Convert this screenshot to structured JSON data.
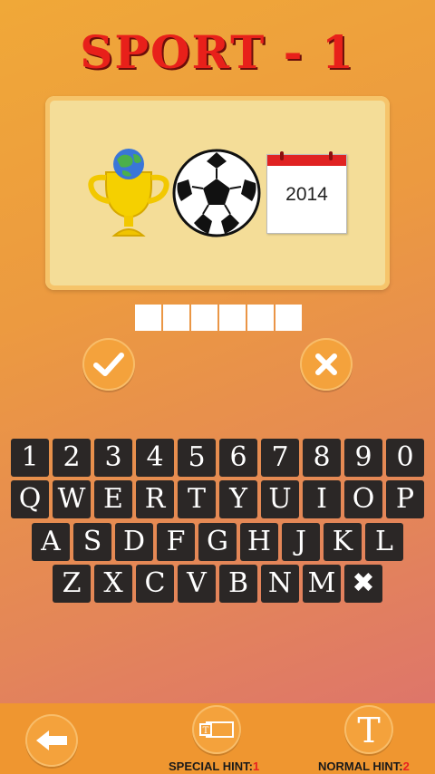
{
  "header": {
    "title": "SPORT  -  1"
  },
  "puzzle": {
    "icons": [
      "world-cup-trophy-icon",
      "soccer-ball-icon",
      "calendar-icon"
    ],
    "calendar_text": "2014",
    "answer_length": 6
  },
  "actions": {
    "confirm_icon": "checkmark-icon",
    "clear_icon": "close-icon"
  },
  "keyboard": {
    "rows": [
      [
        "1",
        "2",
        "3",
        "4",
        "5",
        "6",
        "7",
        "8",
        "9",
        "0"
      ],
      [
        "Q",
        "W",
        "E",
        "R",
        "T",
        "Y",
        "U",
        "I",
        "O",
        "P"
      ],
      [
        "A",
        "S",
        "D",
        "F",
        "G",
        "H",
        "J",
        "K",
        "L"
      ],
      [
        "Z",
        "X",
        "C",
        "V",
        "B",
        "N",
        "M",
        "✖"
      ]
    ]
  },
  "footer": {
    "back_icon": "back-arrow-icon",
    "special_hint_label": "SPECIAL HINT:",
    "special_hint_count": "1",
    "normal_hint_label": "NORMAL HINT:",
    "normal_hint_count": "2"
  },
  "colors": {
    "title": "#e8201a",
    "key_bg": "#2b2726",
    "bottom_bar": "#ef9630",
    "panel": "#f4dd98"
  }
}
